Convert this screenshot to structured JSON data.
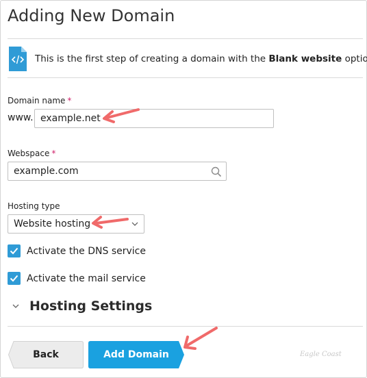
{
  "page": {
    "title": "Adding New Domain",
    "info_text_prefix": "This is the first step of creating a domain with the ",
    "info_text_bold": "Blank website",
    "info_text_suffix": " option."
  },
  "domain_name": {
    "label": "Domain name",
    "required_mark": "*",
    "prefix": "www.",
    "value": "example.net"
  },
  "webspace": {
    "label": "Webspace",
    "required_mark": "*",
    "value": "example.com"
  },
  "hosting_type": {
    "label": "Hosting type",
    "selected": "Website hosting"
  },
  "options": [
    {
      "label": "Activate the DNS service",
      "checked": true
    },
    {
      "label": "Activate the mail service",
      "checked": true
    }
  ],
  "hosting_settings": {
    "label": "Hosting Settings"
  },
  "buttons": {
    "back": "Back",
    "add_domain": "Add Domain"
  },
  "watermark": "Eagle Coast",
  "colors": {
    "accent": "#2f9bd6",
    "primary_button": "#1aa1e0",
    "required": "#d0216a",
    "annotation_arrow": "#f06a6a"
  }
}
